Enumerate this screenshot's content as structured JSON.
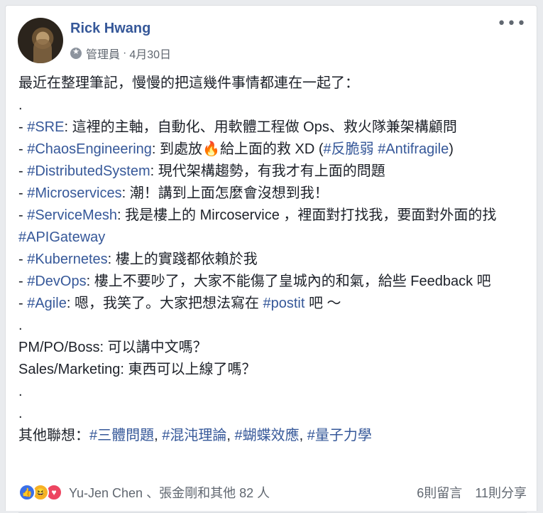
{
  "post": {
    "author": "Rick Hwang",
    "role": "管理員",
    "sep": "·",
    "date": "4月30日",
    "more": "•••"
  },
  "content": {
    "l1": "最近在整理筆記，慢慢的把這幾件事情都連在一起了：",
    "dot": ".",
    "dash": "- ",
    "sre_tag": "#SRE",
    "sre_text": ": 這裡的主軸，自動化、用軟體工程做 Ops、救火隊兼架構顧問",
    "chaos_tag": "#ChaosEngineering",
    "chaos_text_a": ": 到處放",
    "fire": "🔥",
    "chaos_text_b": "給上面的救 XD (",
    "fragile_tag": "#反脆弱",
    "space": " ",
    "antifragile_tag": "#Antifragile",
    "close_paren": ")",
    "dist_tag": "#DistributedSystem",
    "dist_text": ": 現代架構趨勢，有我才有上面的問題",
    "micro_tag": "#Microservices",
    "micro_text": ": 潮！講到上面怎麼會沒想到我！",
    "mesh_tag": "#ServiceMesh",
    "mesh_text": ": 我是樓上的 Mircoservice ，裡面對打找我，要面對外面的找 ",
    "apigw_tag": "#APIGateway",
    "k8s_tag": "#Kubernetes",
    "k8s_text": ": 樓上的實踐都依賴於我",
    "devops_tag": "#DevOps",
    "devops_text": ": 樓上不要吵了，大家不能傷了皇城內的和氣，給些 Feedback 吧",
    "agile_tag": "#Agile",
    "agile_text_a": ": 嗯，我笑了。大家把想法寫在 ",
    "postit_tag": "#postit",
    "agile_text_b": " 吧 ～",
    "pm": "PM/PO/Boss: 可以講中文嗎？",
    "sales": "Sales/Marketing: 東西可以上線了嗎？",
    "other_prefix": "其他聯想：",
    "t1": "#三體問題",
    "comma": ", ",
    "t2": "#混沌理論",
    "t3": "#蝴蝶效應",
    "t4": "#量子力學"
  },
  "footer": {
    "reactions": [
      "like-icon",
      "haha-icon",
      "love-icon"
    ],
    "names": "Yu-Jen Chen 、張金剛和其他 82 人",
    "comments": "6則留言",
    "shares": "11則分享"
  },
  "colors": {
    "link": "#365899",
    "meta": "#606770",
    "background": "#e9ebee"
  }
}
